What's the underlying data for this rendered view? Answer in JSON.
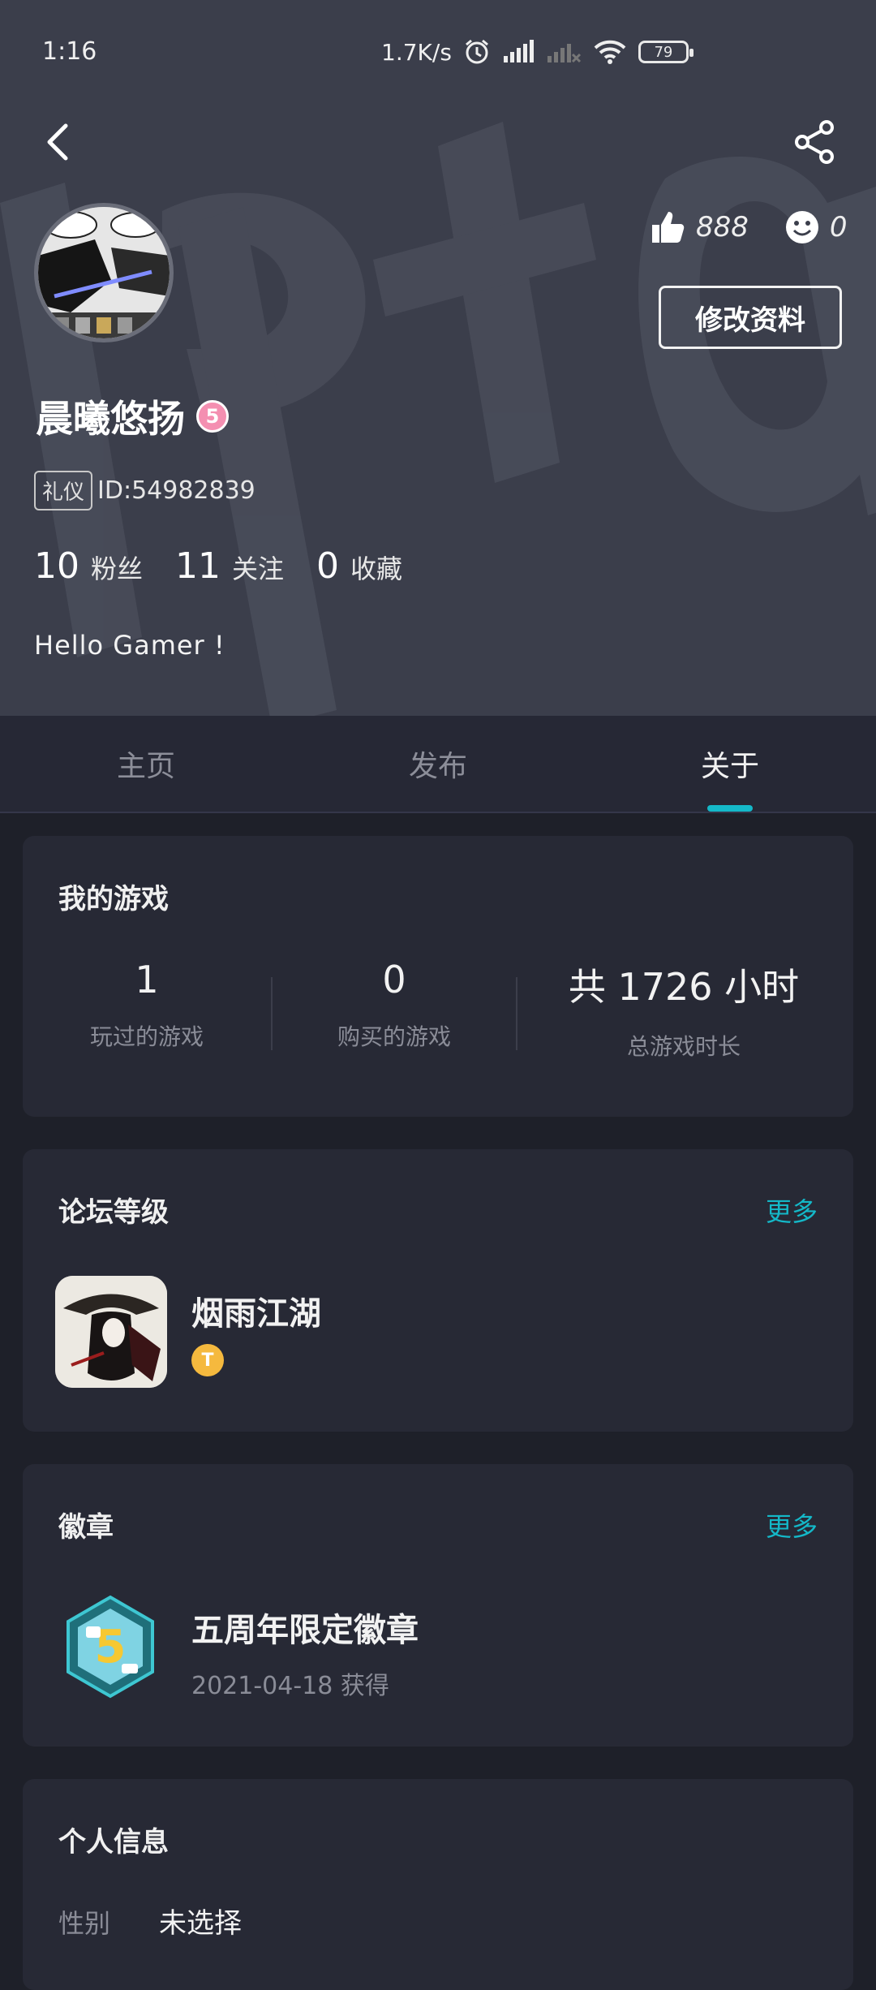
{
  "status_bar": {
    "time": "1:16",
    "net_speed": "1.7K/s",
    "battery": "79"
  },
  "profile": {
    "likes": "888",
    "smiles": "0",
    "edit_label": "修改资料",
    "username": "晨曦悠扬",
    "level": "5",
    "tag": "礼仪",
    "user_id": "ID:54982839",
    "fans_count": "10",
    "fans_label": "粉丝",
    "following_count": "11",
    "following_label": "关注",
    "favorites_count": "0",
    "favorites_label": "收藏",
    "bio": "Hello Gamer !"
  },
  "tabs": [
    {
      "label": "主页"
    },
    {
      "label": "发布"
    },
    {
      "label": "关于"
    }
  ],
  "my_games": {
    "title": "我的游戏",
    "played_count": "1",
    "played_label": "玩过的游戏",
    "bought_count": "0",
    "bought_label": "购买的游戏",
    "total_time": "共 1726 小时",
    "total_time_label": "总游戏时长"
  },
  "forum_level": {
    "title": "论坛等级",
    "more": "更多",
    "game_name": "烟雨江湖",
    "level_letter": "T"
  },
  "badges": {
    "title": "徽章",
    "more": "更多",
    "badge_name": "五周年限定徽章",
    "badge_date": "2021-04-18 获得"
  },
  "personal_info": {
    "title": "个人信息",
    "gender_label": "性别",
    "gender_value": "未选择"
  },
  "colors": {
    "accent": "#14b8c8",
    "header_bg": "#3b3e4b",
    "page_bg": "#1e2029",
    "card_bg": "#272935"
  }
}
